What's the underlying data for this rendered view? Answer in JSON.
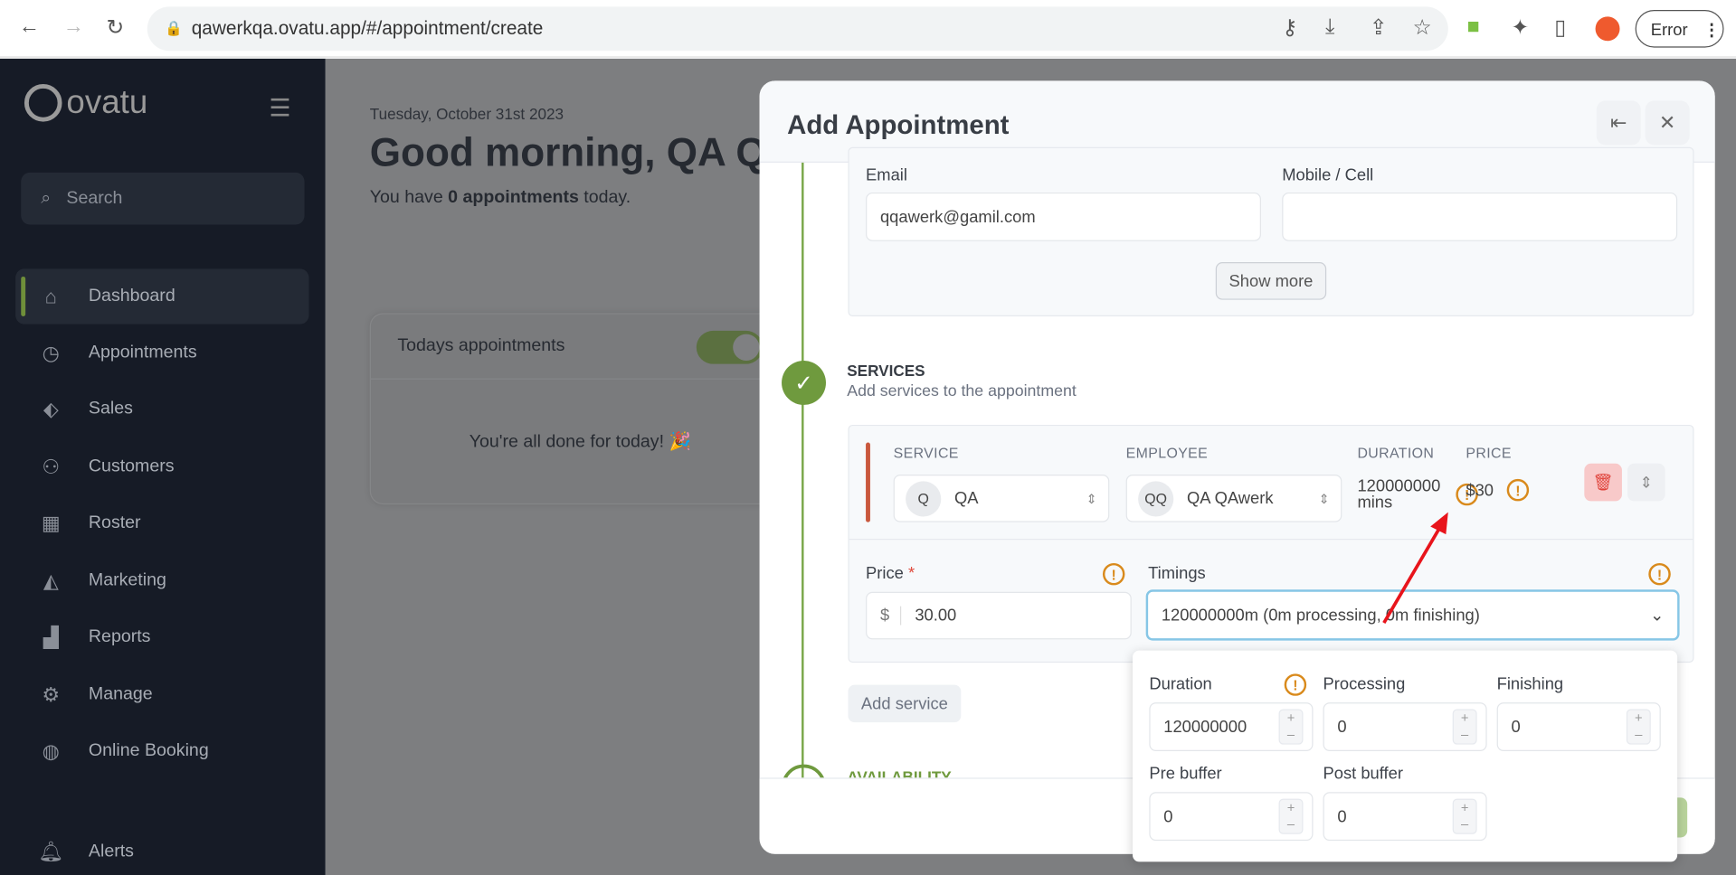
{
  "browser": {
    "url": "qawerkqa.ovatu.app/#/appointment/create",
    "error_label": "Error"
  },
  "sidebar": {
    "logo": "ovatu",
    "search_placeholder": "Search",
    "items": [
      {
        "label": "Dashboard",
        "icon": "home-icon",
        "active": true
      },
      {
        "label": "Appointments",
        "icon": "clock-icon"
      },
      {
        "label": "Sales",
        "icon": "tag-icon"
      },
      {
        "label": "Customers",
        "icon": "users-icon"
      },
      {
        "label": "Roster",
        "icon": "calendar-icon"
      },
      {
        "label": "Marketing",
        "icon": "megaphone-icon"
      },
      {
        "label": "Reports",
        "icon": "chart-icon"
      },
      {
        "label": "Manage",
        "icon": "gear-icon"
      },
      {
        "label": "Online Booking",
        "icon": "globe-icon"
      },
      {
        "label": "Alerts",
        "icon": "bell-icon"
      }
    ]
  },
  "dashboard": {
    "date": "Tuesday, October 31st 2023",
    "greeting": "Good morning, QA Q",
    "summary_pre": "You have ",
    "summary_bold": "0 appointments",
    "summary_post": " today.",
    "card_title": "Todays appointments",
    "empty_text": "You're all done for today! 🎉"
  },
  "modal": {
    "title": "Add Appointment",
    "email_label": "Email",
    "email_value": "qqawerk@gamil.com",
    "mobile_label": "Mobile / Cell",
    "mobile_value": "",
    "show_more": "Show more",
    "services_title": "SERVICES",
    "services_subtitle": "Add services to the appointment",
    "columns": {
      "service": "SERVICE",
      "employee": "EMPLOYEE",
      "duration": "DURATION",
      "price": "PRICE"
    },
    "service": {
      "avatar": "Q",
      "name": "QA"
    },
    "employee": {
      "avatar": "QQ",
      "name": "QA QAwerk"
    },
    "duration_value": "120000000",
    "duration_unit": "mins",
    "price_value": "$30",
    "price_label": "Price",
    "required_mark": "*",
    "currency": "$",
    "price_input": "30.00",
    "timings_label": "Timings",
    "timings_value": "120000000m (0m processing, 0m finishing)",
    "add_service": "Add service",
    "availability": "AVAILABILITY",
    "timings_popup": {
      "duration_label": "Duration",
      "duration": "120000000",
      "processing_label": "Processing",
      "processing": "0",
      "finishing_label": "Finishing",
      "finishing": "0",
      "pre_buffer_label": "Pre buffer",
      "pre_buffer": "0",
      "post_buffer_label": "Post buffer",
      "post_buffer": "0"
    }
  },
  "colors": {
    "sidebar": "#161b26",
    "accent_green": "#6f9a3e",
    "warning": "#d98a1c",
    "service_bar": "#c9583d",
    "annotation_arrow": "#e8141b"
  }
}
